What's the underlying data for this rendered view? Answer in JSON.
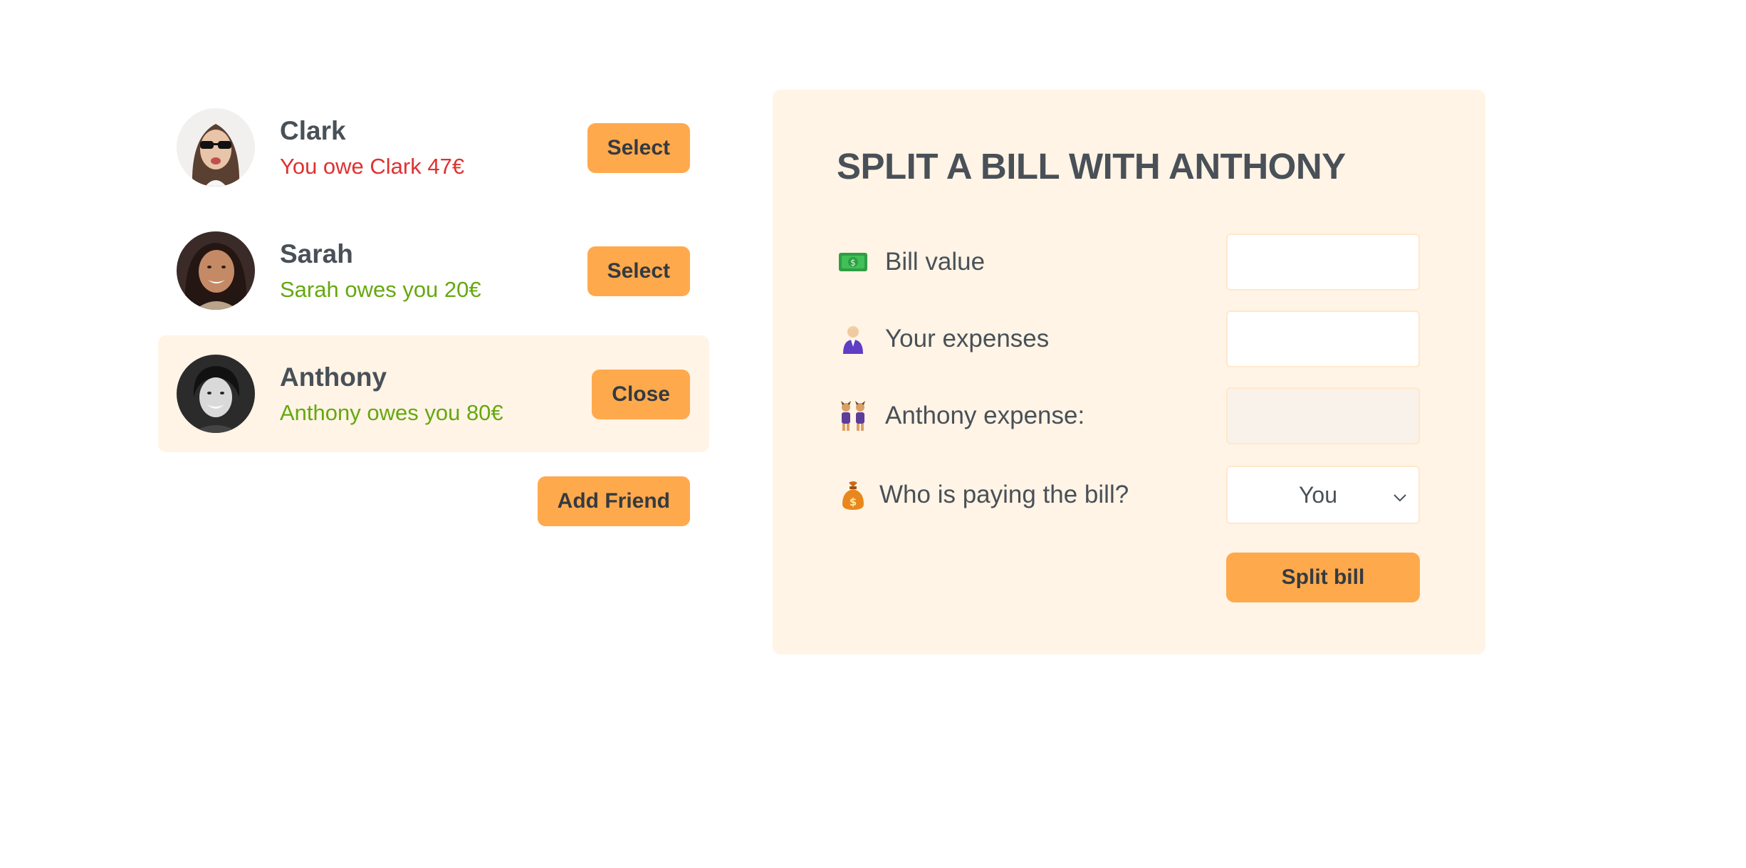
{
  "friends": [
    {
      "name": "Clark",
      "balance": "You owe Clark 47€",
      "balance_type": "negative",
      "button": "Select",
      "selected": false
    },
    {
      "name": "Sarah",
      "balance": "Sarah owes you 20€",
      "balance_type": "positive",
      "button": "Select",
      "selected": false
    },
    {
      "name": "Anthony",
      "balance": "Anthony owes you 80€",
      "balance_type": "positive",
      "button": "Close",
      "selected": true
    }
  ],
  "add_friend_label": "Add Friend",
  "split_form": {
    "title": "SPLIT A BILL WITH ANTHONY",
    "bill_value_label": "Bill value",
    "bill_value_icon": "money-banknote-icon",
    "bill_value": "",
    "your_expense_label": "Your expenses",
    "your_expense_icon": "person-icon",
    "your_expense": "",
    "friend_expense_label": "Anthony expense:",
    "friend_expense_icon": "two-people-icon",
    "friend_expense": "",
    "payer_label": "Who is paying the bill?",
    "payer_icon": "money-bag-icon",
    "payer_selected": "You",
    "submit_label": "Split bill"
  },
  "colors": {
    "accent": "#ffa94d",
    "panel": "#fff4e6",
    "text": "#495057",
    "owe_red": "#e03131",
    "owed_green": "#66a80f"
  }
}
